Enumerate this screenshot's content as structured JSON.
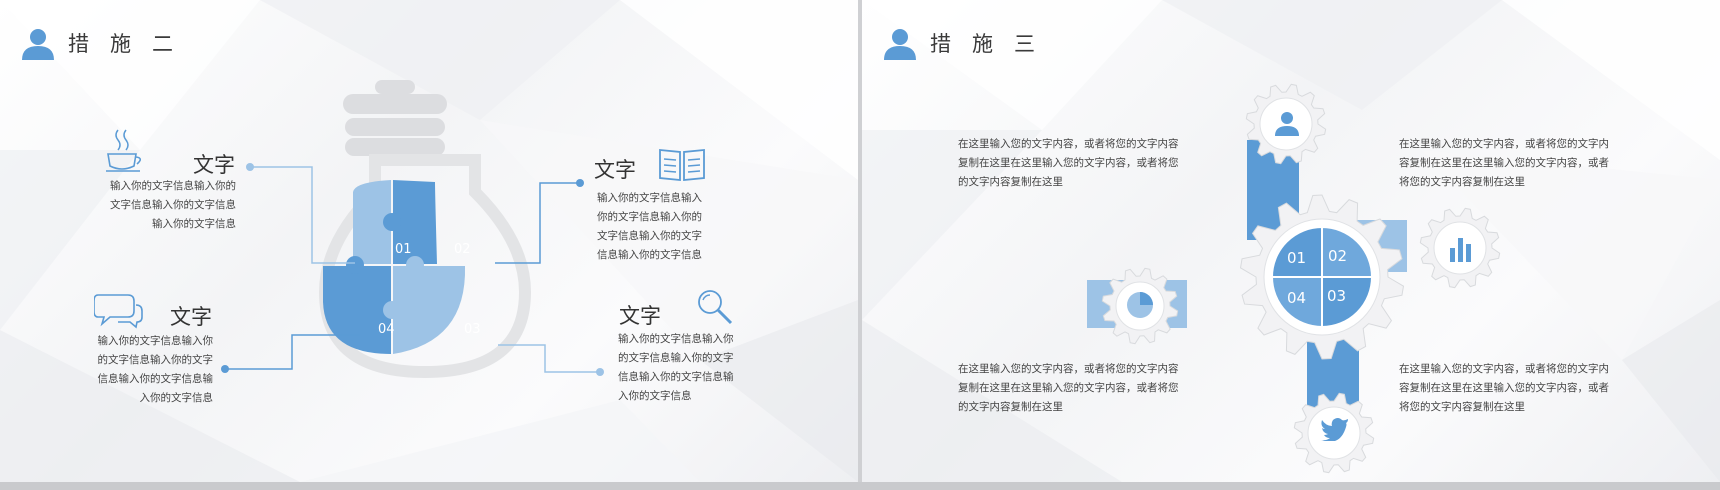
{
  "slide1": {
    "title": "措　施　二",
    "items": [
      {
        "heading": "文字",
        "body": [
          "输入你的文字信息输入你的",
          "文字信息输入你的文字信息",
          "输入你的文字信息"
        ]
      },
      {
        "heading": "文字",
        "body": [
          "输入你的文字信息输入你",
          "的文字信息输入你的文字",
          "信息输入你的文字信息输",
          "入你的文字信息"
        ]
      },
      {
        "heading": "文字",
        "body": [
          "输入你的文字信息输入",
          "你的文字信息输入你的",
          "文字信息输入你的文字",
          "信息输入你的文字信息"
        ]
      },
      {
        "heading": "文字",
        "body": [
          "输入你的文字信息输入你",
          "的文字信息输入你的文字",
          "信息输入你的文字信息输",
          "入你的文字信息"
        ]
      }
    ],
    "puzzle": [
      "01",
      "02",
      "04",
      "03"
    ]
  },
  "slide2": {
    "title": "措　施　三",
    "blocks": [
      [
        "在这里输入您的文字内容，或者将您的文字内容",
        "复制在这里在这里输入您的文字内容，或者将您",
        "的文字内容复制在这里"
      ],
      [
        "在这里输入您的文字内容，或者将您的文字内",
        "容复制在这里在这里输入您的文字内容，或者",
        "将您的文字内容复制在这里"
      ],
      [
        "在这里输入您的文字内容，或者将您的文字内容",
        "复制在这里在这里输入您的文字内容，或者将您",
        "的文字内容复制在这里"
      ],
      [
        "在这里输入您的文字内容，或者将您的文字内",
        "容复制在这里在这里输入您的文字内容，或者",
        "将您的文字内容复制在这里"
      ]
    ],
    "gear": [
      "01",
      "02",
      "04",
      "03"
    ]
  },
  "colors": {
    "accent": "#5b9bd5",
    "light": "#9dc3e6",
    "gear": "#f2f2f2",
    "text": "#444444"
  }
}
